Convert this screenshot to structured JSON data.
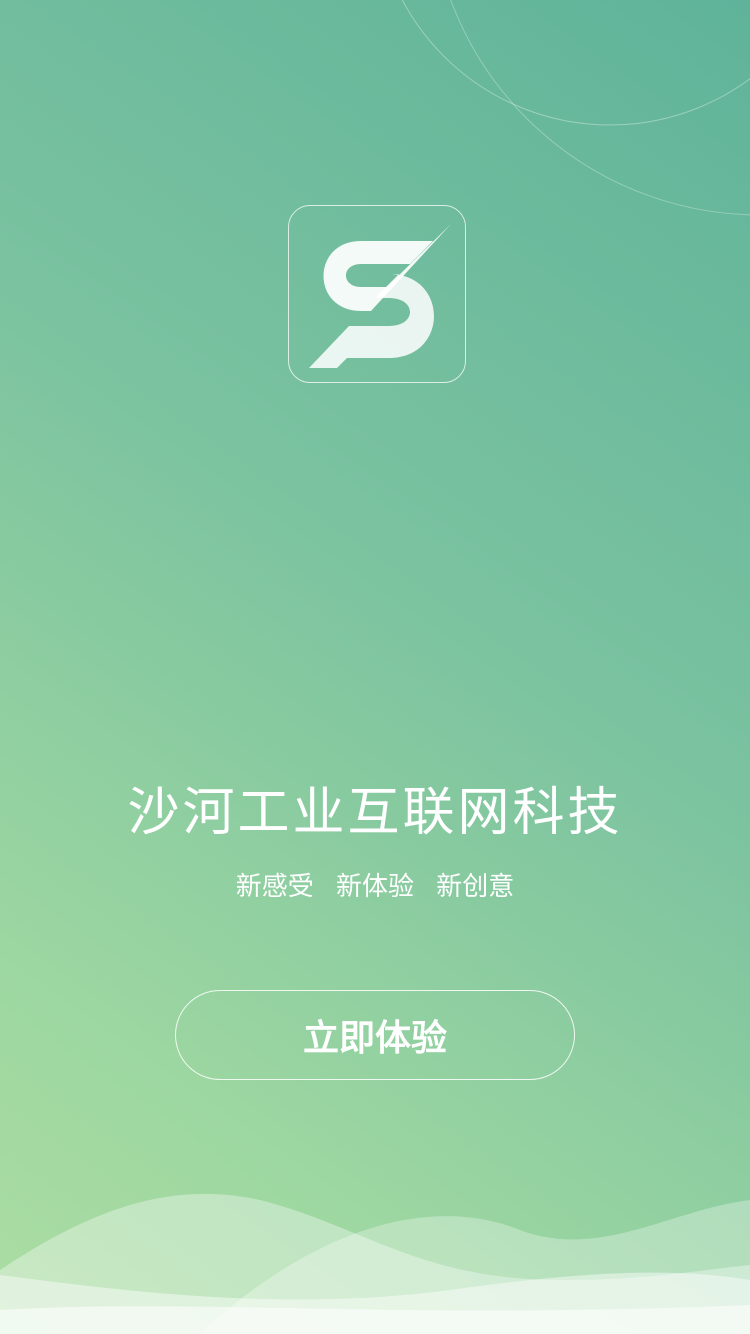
{
  "brand": {
    "title": "沙河工业互联网科技",
    "logo_icon": "s-logo-icon",
    "slogans": [
      "新感受",
      "新体验",
      "新创意"
    ]
  },
  "cta": {
    "label": "立即体验"
  },
  "colors": {
    "gradient_top_right": "#5fb39a",
    "gradient_bottom_left": "#acdda2",
    "text": "#ffffff"
  }
}
